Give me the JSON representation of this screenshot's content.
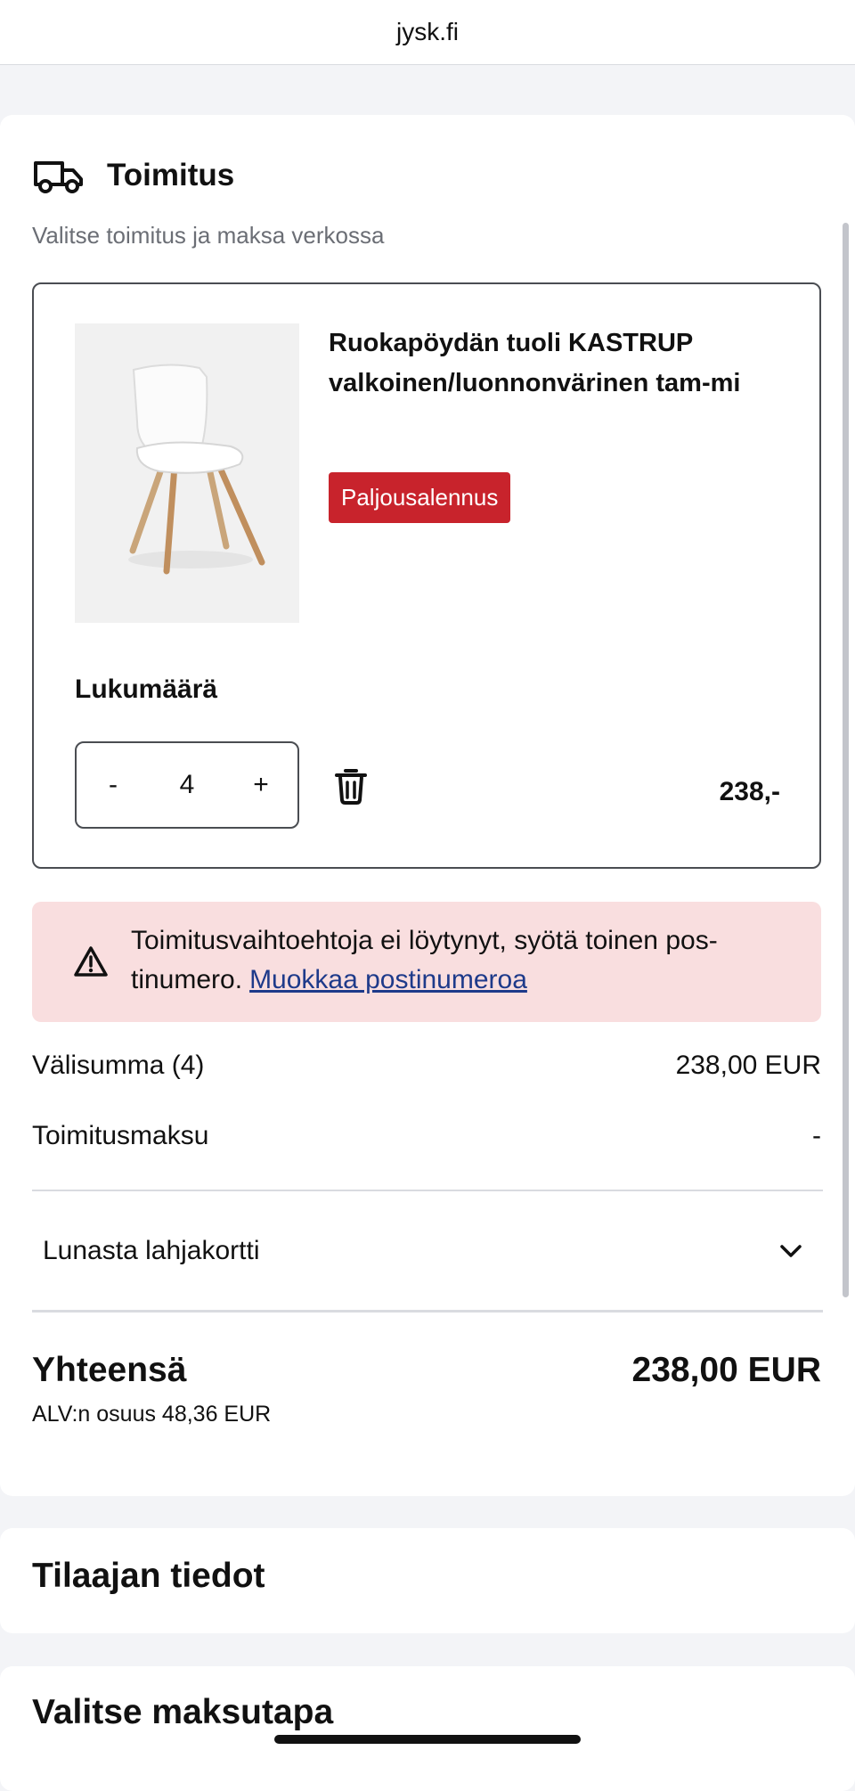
{
  "browser": {
    "url": "jysk.fi"
  },
  "delivery": {
    "title": "Toimitus",
    "subtitle": "Valitse toimitus ja maksa verkossa",
    "icon": "truck-icon"
  },
  "product": {
    "name": "Ruokapöydän tuoli KASTRUP valkoinen/luonnonvärinen tam-mi",
    "badge": "Paljousalennus",
    "quantity_label": "Lukumäärä",
    "quantity": "4",
    "decrement": "-",
    "increment": "+",
    "price": "238,-",
    "badge_color": "#c8232c"
  },
  "alert": {
    "message": "Toimitusvaihtoehtoja ei löytynyt, syötä toinen pos-tinumero.",
    "link": "Muokkaa postinumeroa",
    "background": "#f9dedf"
  },
  "summary": {
    "subtotal_label": "Välisumma (4)",
    "subtotal_value": "238,00 EUR",
    "shipping_label": "Toimitusmaksu",
    "shipping_value": "-",
    "giftcard_label": "Lunasta lahjakortti",
    "total_label": "Yhteensä",
    "total_value": "238,00 EUR",
    "vat": "ALV:n osuus 48,36 EUR"
  },
  "sections": {
    "customer": "Tilaajan tiedot",
    "payment": "Valitse maksutapa"
  }
}
